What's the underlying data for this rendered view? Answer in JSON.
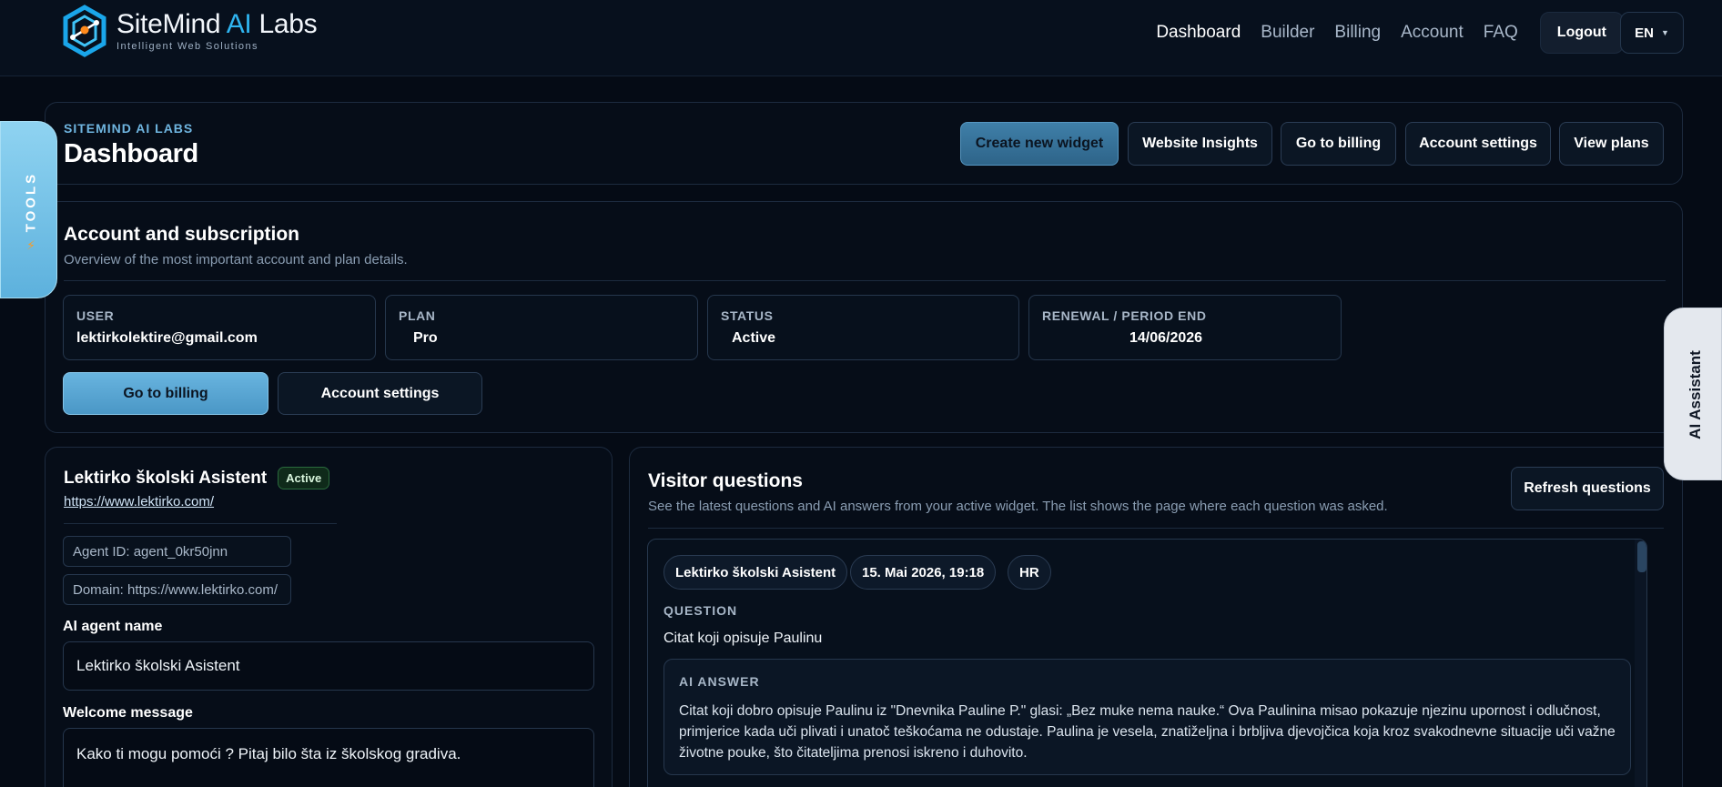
{
  "header": {
    "brand_main": "SiteMind ",
    "brand_ai": "AI",
    "brand_tail": " Labs",
    "brand_sub": "Intelligent Web Solutions",
    "nav": [
      {
        "label": "Dashboard",
        "active": true
      },
      {
        "label": "Builder",
        "active": false
      },
      {
        "label": "Billing",
        "active": false
      },
      {
        "label": "Account",
        "active": false
      },
      {
        "label": "FAQ",
        "active": false
      }
    ],
    "logout_label": "Logout",
    "language": "EN",
    "lang_caret": "▼"
  },
  "page_header": {
    "eyebrow": "SITEMIND AI LABS",
    "title": "Dashboard",
    "actions": {
      "create_widget": "Create new widget",
      "insights": "Website Insights",
      "billing": "Go to billing",
      "account_settings": "Account settings",
      "plans": "View plans"
    }
  },
  "subscription": {
    "title": "Account and subscription",
    "subtitle": "Overview of the most important account and plan details.",
    "cards": {
      "user": {
        "label": "USER",
        "value": "lektirkolektire@gmail.com"
      },
      "plan": {
        "label": "PLAN",
        "value": "Pro"
      },
      "status": {
        "label": "STATUS",
        "value": "Active"
      },
      "renewal": {
        "label": "RENEWAL / PERIOD END",
        "value": "14/06/2026"
      }
    },
    "billing_button": "Go to billing",
    "settings_button": "Account settings"
  },
  "agent": {
    "name": "Lektirko školski Asistent",
    "status": "Active",
    "url": "https://www.lektirko.com/",
    "agent_id": "Agent ID: agent_0kr50jnn",
    "domain": "Domain: https://www.lektirko.com/",
    "name_label": "AI agent name",
    "name_value": "Lektirko školski Asistent",
    "welcome_label": "Welcome message",
    "welcome_value": "Kako ti mogu pomoći ? Pitaj bilo šta iz školskog gradiva."
  },
  "visitor_questions": {
    "title": "Visitor questions",
    "subtitle": "See the latest questions and AI answers from your active widget. The list shows the page where each question was asked.",
    "refresh_label": "Refresh questions",
    "items": [
      {
        "agent": "Lektirko školski Asistent",
        "datetime": "15. Mai 2026, 19:18",
        "lang": "HR",
        "question_label": "QUESTION",
        "question": "Citat koji opisuje Paulinu",
        "answer_label": "AI ANSWER",
        "answer": "Citat koji dobro opisuje Paulinu iz \"Dnevnika Pauline P.\" glasi: „Bez muke nema nauke.“ Ova Paulinina misao pokazuje njezinu upornost i odlučnost, primjerice kada uči plivati i unatoč teškoćama ne odustaje. Paulina je vesela, znatiželjna i brbljiva djevojčica koja kroz svakodnevne situacije uči važne životne pouke, što čitateljima prenosi iskreno i duhovito."
      }
    ]
  },
  "side_tabs": {
    "tools": "TOOLS",
    "assistant": "AI Assistant"
  },
  "colors": {
    "background": "#050b15",
    "accent": "#2fb4f0",
    "primary_button": "#4a97c6",
    "active_badge": "#2a6a3d"
  }
}
